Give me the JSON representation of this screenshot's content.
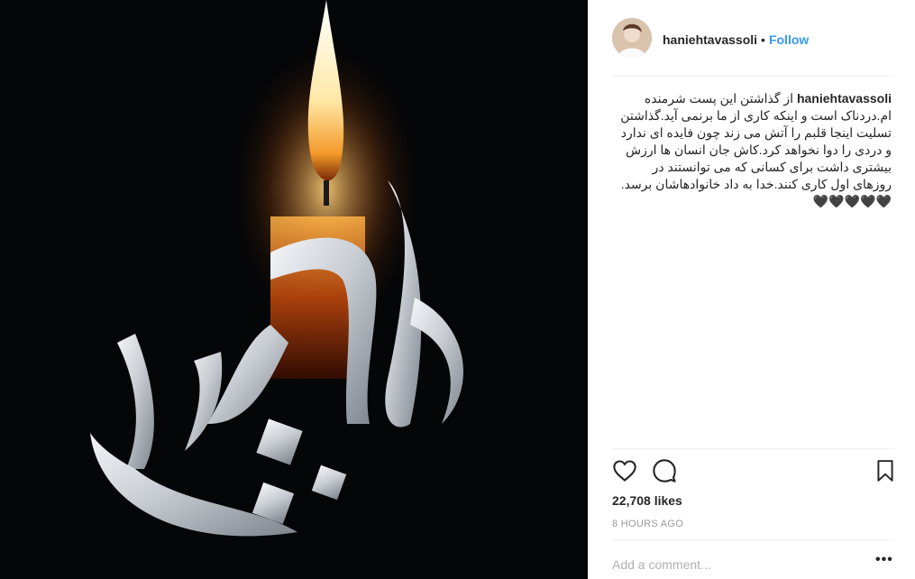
{
  "post": {
    "image_alt": "candle with calligraphy"
  },
  "header": {
    "username": "haniehtavassoli",
    "separator": "•",
    "follow_label": "Follow"
  },
  "caption": {
    "username": "haniehtavassoli",
    "text": "از گذاشتن این پست شرمنده ام.دردناک است و اینکه کاری از ما برنمی آید.گذاشتن تسلیت اینجا قلبم را آتش می زند چون فایده ای ندارد و دردی را دوا نخواهد کرد.کاش جان انسان ها ارزش بیشتری داشت برای کسانی که می توانستند در روزهای اول کاری کنند.خدا به داد خانوادهاشان برسد.🖤🖤🖤🖤🖤"
  },
  "actions": {
    "like_icon": "heart-icon",
    "comment_icon": "comment-icon",
    "save_icon": "bookmark-icon"
  },
  "stats": {
    "likes": "22,708 likes",
    "time": "8 HOURS AGO"
  },
  "comment": {
    "placeholder": "Add a comment...",
    "more_label": "•••"
  },
  "colors": {
    "accent": "#3897f0",
    "text": "#262626",
    "muted": "#999999"
  }
}
